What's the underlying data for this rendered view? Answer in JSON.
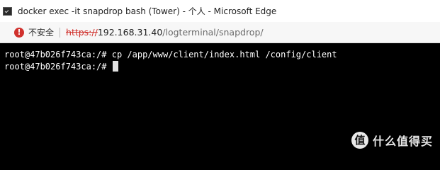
{
  "window": {
    "title": "docker exec -it snapdrop bash (Tower) - 个人 - Microsoft Edge",
    "icon": "terminal-icon"
  },
  "addressbar": {
    "security_icon": "not-secure-icon",
    "security_label": "不安全",
    "url_scheme": "https://",
    "url_host": "192.168.31.40",
    "url_path": "/logterminal/snapdrop/"
  },
  "terminal": {
    "lines": [
      "root@47b026f743ca:/# cp /app/www/client/index.html /config/client",
      "root@47b026f743ca:/# "
    ]
  },
  "watermark": {
    "logo_glyph": "值",
    "text": "什么值得买"
  },
  "colors": {
    "terminal_bg": "#000000",
    "terminal_fg": "#ffffff",
    "insecure": "#d0312d"
  }
}
